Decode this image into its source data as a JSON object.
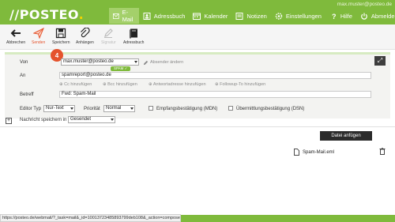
{
  "header": {
    "logo": "//POSTEO",
    "logo_dot": ".",
    "user": "max.muster@posteo.de",
    "nav": [
      {
        "label": "E-Mail",
        "icon": "envelope-icon",
        "active": true
      },
      {
        "label": "Adressbuch",
        "icon": "address-book-icon"
      },
      {
        "label": "Kalender",
        "icon": "calendar-icon"
      },
      {
        "label": "Notizen",
        "icon": "notes-icon"
      },
      {
        "label": "Einstellungen",
        "icon": "gear-icon"
      },
      {
        "label": "Hilfe",
        "icon": "help-icon"
      },
      {
        "label": "Abmelden",
        "icon": "power-icon"
      }
    ]
  },
  "toolbar": {
    "abbrechen": "Abbrechen",
    "senden": "Senden",
    "speichern": "Speichern",
    "anhaengen": "Anhängen",
    "signatur": "Signatur",
    "adressbuch": "Adressbuch"
  },
  "badge": "4",
  "compose": {
    "von_label": "Von",
    "von_value": "max.muster@posteo.de",
    "absender_link": "Absender ändern",
    "an_label": "An",
    "chip": "SPAM ✓",
    "an_value": "spamreport@posteo.de",
    "links": [
      "Cc hinzufügen",
      "Bcc hinzufügen",
      "Antwortadresse hinzufügen",
      "Followup-To hinzufügen"
    ],
    "betreff_label": "Betreff",
    "betreff_value": "Fwd: Spam-Mail",
    "editor_label": "Editor Typ",
    "editor_value": "Nur-Text",
    "prioritaet_label": "Priorität",
    "prioritaet_value": "Normal",
    "mdn_label": "Empfangsbestätigung (MDN)",
    "dsn_label": "Übermittlungsbestätigung (DSN)",
    "save_label": "Nachricht speichern in",
    "save_value": "Gesendet"
  },
  "attachments": {
    "button": "Datei anfügen",
    "files": [
      "Spam-Mail.eml"
    ]
  },
  "statusbar": "https://posteo.de/webmail/?_task=mail&_id=10013723485893799deb108&_action=compose"
}
